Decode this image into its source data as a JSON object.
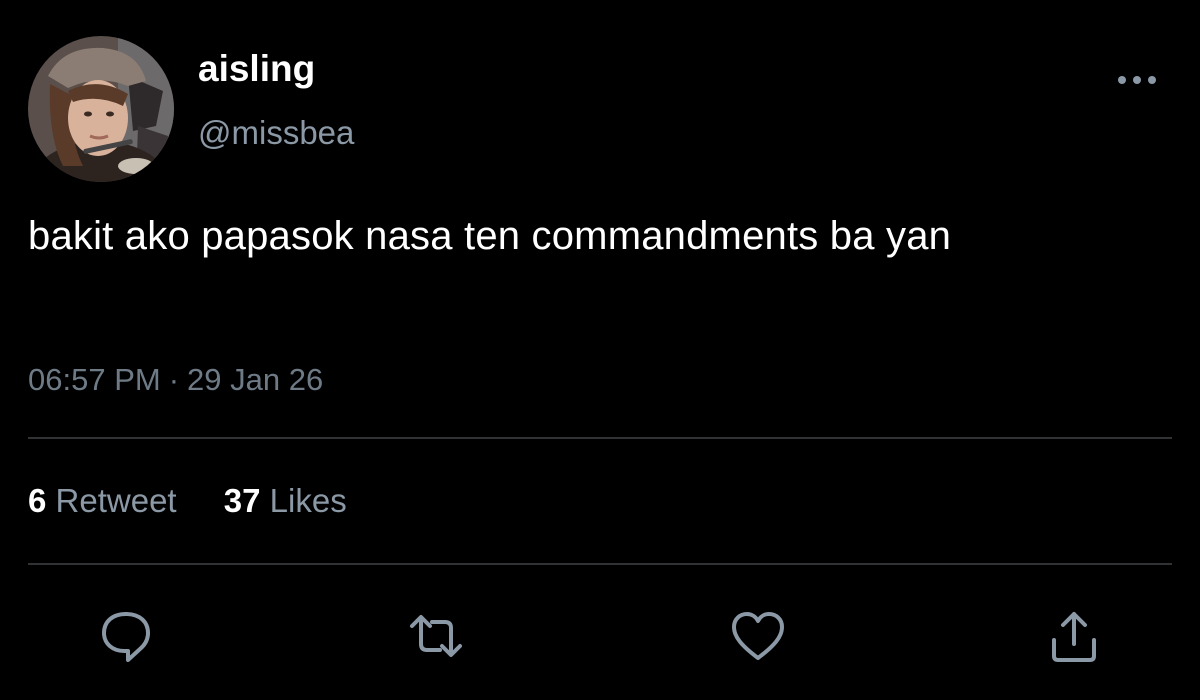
{
  "tweet": {
    "author": {
      "display_name": "aisling",
      "handle": "@missbea"
    },
    "text": "bakit ako papasok nasa ten commandments ba yan",
    "time": "06:57 PM",
    "separator": "·",
    "date": "29 Jan 26",
    "stats": {
      "retweet_count": "6",
      "retweet_label": "Retweet",
      "like_count": "37",
      "like_label": "Likes"
    }
  },
  "icons": {
    "more": "more-horizontal-icon",
    "reply": "reply-icon",
    "retweet": "retweet-icon",
    "like": "heart-icon",
    "share": "share-icon"
  },
  "colors": {
    "background": "#000000",
    "primary_text": "#ffffff",
    "secondary_text": "#8b98a5",
    "divider": "#2f3336",
    "icon": "#8b98a5"
  }
}
